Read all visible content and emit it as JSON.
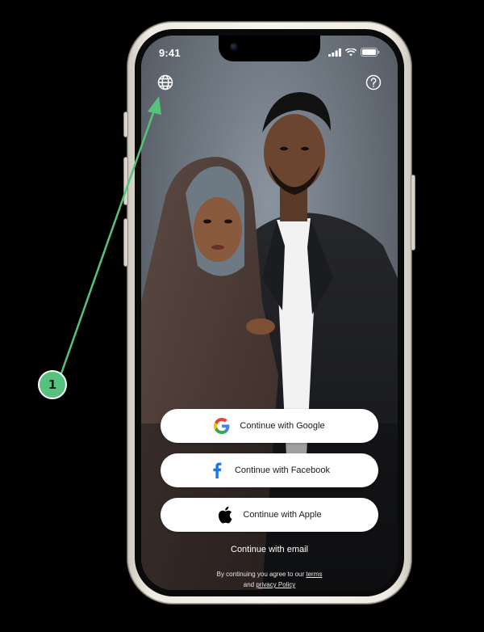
{
  "status_bar": {
    "time": "9:41"
  },
  "top_bar": {
    "language_icon": "globe-icon",
    "help_icon": "help-circle-icon"
  },
  "auth_buttons": [
    {
      "label": "Continue with Google",
      "icon": "google-icon"
    },
    {
      "label": "Continue with Facebook",
      "icon": "facebook-icon"
    },
    {
      "label": "Continue with Apple",
      "icon": "apple-icon"
    }
  ],
  "email_link": "Continue with email",
  "legal": {
    "prefix": "By continuing you agree to our",
    "terms": "terms",
    "and": "and",
    "privacy": "privacy Policy"
  },
  "annotation": {
    "number": "1",
    "color": "#57c27e"
  },
  "colors": {
    "google_blue": "#4285F4",
    "google_red": "#EA4335",
    "google_yellow": "#FBBC05",
    "google_green": "#34A853",
    "facebook_blue": "#1877F2"
  }
}
